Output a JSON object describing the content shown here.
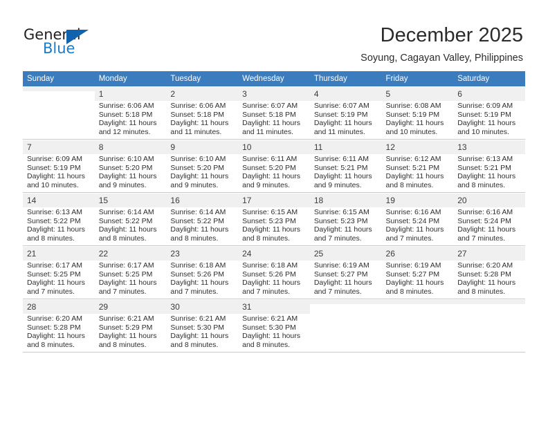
{
  "brand": {
    "name_part1": "General",
    "name_part2": "Blue",
    "accent_color": "#1263ad",
    "logo_icon": "triangle-icon"
  },
  "header": {
    "title": "December 2025",
    "subtitle": "Soyung, Cagayan Valley, Philippines"
  },
  "calendar": {
    "header_bg": "#3b7cbf",
    "weekday_headers": [
      "Sunday",
      "Monday",
      "Tuesday",
      "Wednesday",
      "Thursday",
      "Friday",
      "Saturday"
    ],
    "weeks": [
      [
        {
          "day": "",
          "lines": []
        },
        {
          "day": "1",
          "lines": [
            "Sunrise: 6:06 AM",
            "Sunset: 5:18 PM",
            "Daylight: 11 hours",
            "and 12 minutes."
          ]
        },
        {
          "day": "2",
          "lines": [
            "Sunrise: 6:06 AM",
            "Sunset: 5:18 PM",
            "Daylight: 11 hours",
            "and 11 minutes."
          ]
        },
        {
          "day": "3",
          "lines": [
            "Sunrise: 6:07 AM",
            "Sunset: 5:18 PM",
            "Daylight: 11 hours",
            "and 11 minutes."
          ]
        },
        {
          "day": "4",
          "lines": [
            "Sunrise: 6:07 AM",
            "Sunset: 5:19 PM",
            "Daylight: 11 hours",
            "and 11 minutes."
          ]
        },
        {
          "day": "5",
          "lines": [
            "Sunrise: 6:08 AM",
            "Sunset: 5:19 PM",
            "Daylight: 11 hours",
            "and 10 minutes."
          ]
        },
        {
          "day": "6",
          "lines": [
            "Sunrise: 6:09 AM",
            "Sunset: 5:19 PM",
            "Daylight: 11 hours",
            "and 10 minutes."
          ]
        }
      ],
      [
        {
          "day": "7",
          "lines": [
            "Sunrise: 6:09 AM",
            "Sunset: 5:19 PM",
            "Daylight: 11 hours",
            "and 10 minutes."
          ]
        },
        {
          "day": "8",
          "lines": [
            "Sunrise: 6:10 AM",
            "Sunset: 5:20 PM",
            "Daylight: 11 hours",
            "and 9 minutes."
          ]
        },
        {
          "day": "9",
          "lines": [
            "Sunrise: 6:10 AM",
            "Sunset: 5:20 PM",
            "Daylight: 11 hours",
            "and 9 minutes."
          ]
        },
        {
          "day": "10",
          "lines": [
            "Sunrise: 6:11 AM",
            "Sunset: 5:20 PM",
            "Daylight: 11 hours",
            "and 9 minutes."
          ]
        },
        {
          "day": "11",
          "lines": [
            "Sunrise: 6:11 AM",
            "Sunset: 5:21 PM",
            "Daylight: 11 hours",
            "and 9 minutes."
          ]
        },
        {
          "day": "12",
          "lines": [
            "Sunrise: 6:12 AM",
            "Sunset: 5:21 PM",
            "Daylight: 11 hours",
            "and 8 minutes."
          ]
        },
        {
          "day": "13",
          "lines": [
            "Sunrise: 6:13 AM",
            "Sunset: 5:21 PM",
            "Daylight: 11 hours",
            "and 8 minutes."
          ]
        }
      ],
      [
        {
          "day": "14",
          "lines": [
            "Sunrise: 6:13 AM",
            "Sunset: 5:22 PM",
            "Daylight: 11 hours",
            "and 8 minutes."
          ]
        },
        {
          "day": "15",
          "lines": [
            "Sunrise: 6:14 AM",
            "Sunset: 5:22 PM",
            "Daylight: 11 hours",
            "and 8 minutes."
          ]
        },
        {
          "day": "16",
          "lines": [
            "Sunrise: 6:14 AM",
            "Sunset: 5:22 PM",
            "Daylight: 11 hours",
            "and 8 minutes."
          ]
        },
        {
          "day": "17",
          "lines": [
            "Sunrise: 6:15 AM",
            "Sunset: 5:23 PM",
            "Daylight: 11 hours",
            "and 8 minutes."
          ]
        },
        {
          "day": "18",
          "lines": [
            "Sunrise: 6:15 AM",
            "Sunset: 5:23 PM",
            "Daylight: 11 hours",
            "and 7 minutes."
          ]
        },
        {
          "day": "19",
          "lines": [
            "Sunrise: 6:16 AM",
            "Sunset: 5:24 PM",
            "Daylight: 11 hours",
            "and 7 minutes."
          ]
        },
        {
          "day": "20",
          "lines": [
            "Sunrise: 6:16 AM",
            "Sunset: 5:24 PM",
            "Daylight: 11 hours",
            "and 7 minutes."
          ]
        }
      ],
      [
        {
          "day": "21",
          "lines": [
            "Sunrise: 6:17 AM",
            "Sunset: 5:25 PM",
            "Daylight: 11 hours",
            "and 7 minutes."
          ]
        },
        {
          "day": "22",
          "lines": [
            "Sunrise: 6:17 AM",
            "Sunset: 5:25 PM",
            "Daylight: 11 hours",
            "and 7 minutes."
          ]
        },
        {
          "day": "23",
          "lines": [
            "Sunrise: 6:18 AM",
            "Sunset: 5:26 PM",
            "Daylight: 11 hours",
            "and 7 minutes."
          ]
        },
        {
          "day": "24",
          "lines": [
            "Sunrise: 6:18 AM",
            "Sunset: 5:26 PM",
            "Daylight: 11 hours",
            "and 7 minutes."
          ]
        },
        {
          "day": "25",
          "lines": [
            "Sunrise: 6:19 AM",
            "Sunset: 5:27 PM",
            "Daylight: 11 hours",
            "and 7 minutes."
          ]
        },
        {
          "day": "26",
          "lines": [
            "Sunrise: 6:19 AM",
            "Sunset: 5:27 PM",
            "Daylight: 11 hours",
            "and 8 minutes."
          ]
        },
        {
          "day": "27",
          "lines": [
            "Sunrise: 6:20 AM",
            "Sunset: 5:28 PM",
            "Daylight: 11 hours",
            "and 8 minutes."
          ]
        }
      ],
      [
        {
          "day": "28",
          "lines": [
            "Sunrise: 6:20 AM",
            "Sunset: 5:28 PM",
            "Daylight: 11 hours",
            "and 8 minutes."
          ]
        },
        {
          "day": "29",
          "lines": [
            "Sunrise: 6:21 AM",
            "Sunset: 5:29 PM",
            "Daylight: 11 hours",
            "and 8 minutes."
          ]
        },
        {
          "day": "30",
          "lines": [
            "Sunrise: 6:21 AM",
            "Sunset: 5:30 PM",
            "Daylight: 11 hours",
            "and 8 minutes."
          ]
        },
        {
          "day": "31",
          "lines": [
            "Sunrise: 6:21 AM",
            "Sunset: 5:30 PM",
            "Daylight: 11 hours",
            "and 8 minutes."
          ]
        },
        {
          "day": "",
          "lines": []
        },
        {
          "day": "",
          "lines": []
        },
        {
          "day": "",
          "lines": []
        }
      ]
    ]
  }
}
